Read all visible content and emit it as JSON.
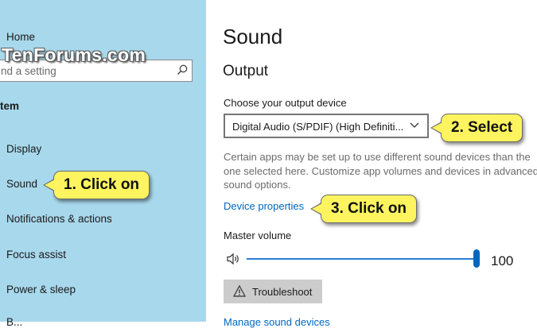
{
  "sidebar": {
    "home": "Home",
    "search_placeholder": "nd a setting",
    "category": "tem",
    "items": [
      {
        "label": "Display"
      },
      {
        "label": "Sound"
      },
      {
        "label": "Notifications & actions"
      },
      {
        "label": "Focus assist"
      },
      {
        "label": "Power & sleep"
      },
      {
        "label": "B..."
      }
    ]
  },
  "watermark": "TenForums.com",
  "main": {
    "title": "Sound",
    "section": "Output",
    "output_device_label": "Choose your output device",
    "output_device_value": "Digital Audio (S/PDIF) (High Definiti...",
    "description": "Certain apps may be set up to use different sound devices than the one selected here. Customize app volumes and devices in advanced sound options.",
    "device_properties_link": "Device properties",
    "master_volume_label": "Master volume",
    "master_volume_value": "100",
    "troubleshoot_label": "Troubleshoot",
    "manage_devices_link": "Manage sound devices"
  },
  "callouts": {
    "step1": "1. Click on",
    "step2": "2. Select",
    "step3": "3. Click on"
  },
  "colors": {
    "sidebar_bg": "#a8d8ec",
    "accent": "#0067c0",
    "callout_bg": "#fdf45f"
  }
}
